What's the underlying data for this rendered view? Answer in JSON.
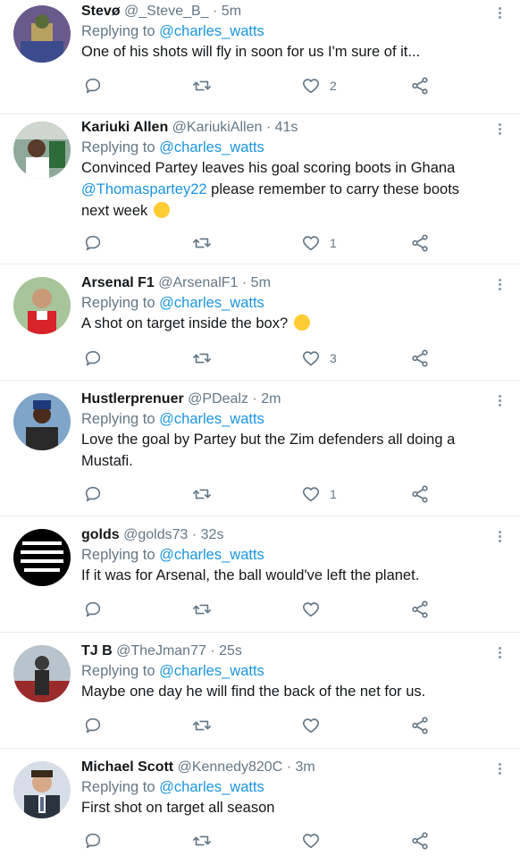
{
  "reply_prefix": "Replying to",
  "colors": {
    "link": "#1b95e0",
    "muted": "#657786",
    "divider": "#e6ecf0"
  },
  "icons": {
    "reply": "reply-icon",
    "retweet": "retweet-icon",
    "like": "heart-icon",
    "share": "share-icon",
    "more": "more-vertical-icon"
  },
  "tweets": [
    {
      "name": "Stevø",
      "handle": "@_Steve_B_",
      "time": "· 5m",
      "replying_to": "@charles_watts",
      "text": "One of his shots will fly in soon for us I'm sure of it...",
      "text2": "",
      "mention": "",
      "likes": "2"
    },
    {
      "name": "Kariuki Allen",
      "handle": "@KariukiAllen",
      "time": "· 41s",
      "replying_to": "@charles_watts",
      "text": "Convinced Partey leaves his goal scoring boots in Ghana",
      "mention": "@Thomaspartey22",
      "text2": " please remember to carry these boots next week",
      "emoji": "grin-sweat",
      "likes": "1"
    },
    {
      "name": "Arsenal F1",
      "handle": "@ArsenalF1",
      "time": "· 5m",
      "replying_to": "@charles_watts",
      "text": "A shot on target inside the box?",
      "text2": "",
      "mention": "",
      "emoji": "surprised",
      "likes": "3"
    },
    {
      "name": "Hustlerprenuer",
      "handle": "@PDealz",
      "time": "· 2m",
      "replying_to": "@charles_watts",
      "text": "Love the goal by Partey but the Zim defenders all doing a Mustafi.",
      "text2": "",
      "mention": "",
      "likes": "1"
    },
    {
      "name": "golds",
      "handle": "@golds73",
      "time": "· 32s",
      "replying_to": "@charles_watts",
      "text": "If it was for Arsenal, the ball would've left the planet.",
      "text2": "",
      "mention": "",
      "likes": ""
    },
    {
      "name": "TJ B",
      "handle": "@TheJman77",
      "time": "· 25s",
      "replying_to": "@charles_watts",
      "text": "Maybe one day he will find the back of the net for us.",
      "text2": "",
      "mention": "",
      "likes": ""
    },
    {
      "name": "Michael Scott",
      "handle": "@Kennedy820C",
      "time": "· 3m",
      "replying_to": "@charles_watts",
      "text": "First shot on target all season",
      "text2": "",
      "mention": "",
      "likes": ""
    }
  ]
}
